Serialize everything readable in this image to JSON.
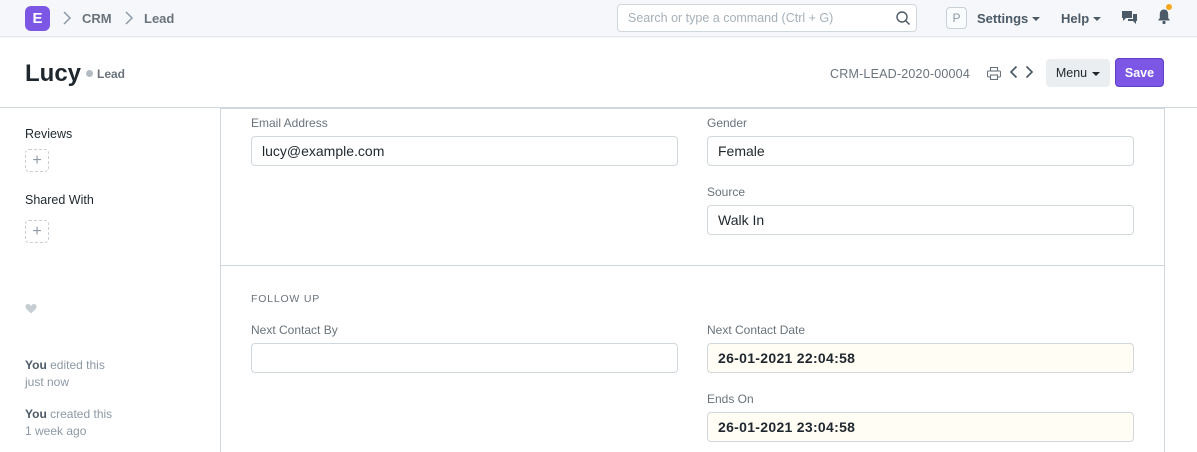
{
  "navbar": {
    "logo_letter": "E",
    "breadcrumbs": [
      "CRM",
      "Lead"
    ],
    "search_placeholder": "Search or type a command (Ctrl + G)",
    "user_initial": "P",
    "settings_label": "Settings",
    "help_label": "Help",
    "icons": [
      "chevron-right-icon",
      "search-icon",
      "chat-icon",
      "bell-icon"
    ],
    "accent_color": "#7c57e6",
    "notification_color": "#f4a81e"
  },
  "page": {
    "title": "Lucy",
    "status": "Lead",
    "doc_name": "CRM-LEAD-2020-00004",
    "menu_label": "Menu",
    "save_label": "Save",
    "icons": [
      "print-icon",
      "chevron-left-icon",
      "chevron-right-icon"
    ]
  },
  "sidebar": {
    "reviews_label": "Reviews",
    "shared_with_label": "Shared With",
    "add_symbol": "+",
    "activity": [
      {
        "actor": "You",
        "action": "edited this",
        "when": "just now"
      },
      {
        "actor": "You",
        "action": "created this",
        "when": "1 week ago"
      }
    ],
    "icons": [
      "plus-icon",
      "heart-icon"
    ]
  },
  "form": {
    "email_label": "Email Address",
    "email_value": "lucy@example.com",
    "gender_label": "Gender",
    "gender_value": "Female",
    "source_label": "Source",
    "source_value": "Walk In",
    "followup_title": "FOLLOW UP",
    "next_contact_by_label": "Next Contact By",
    "next_contact_by_value": "",
    "next_contact_date_label": "Next Contact Date",
    "next_contact_date_value": "26-01-2021 22:04:58",
    "ends_on_label": "Ends On",
    "ends_on_value": "26-01-2021 23:04:58"
  }
}
